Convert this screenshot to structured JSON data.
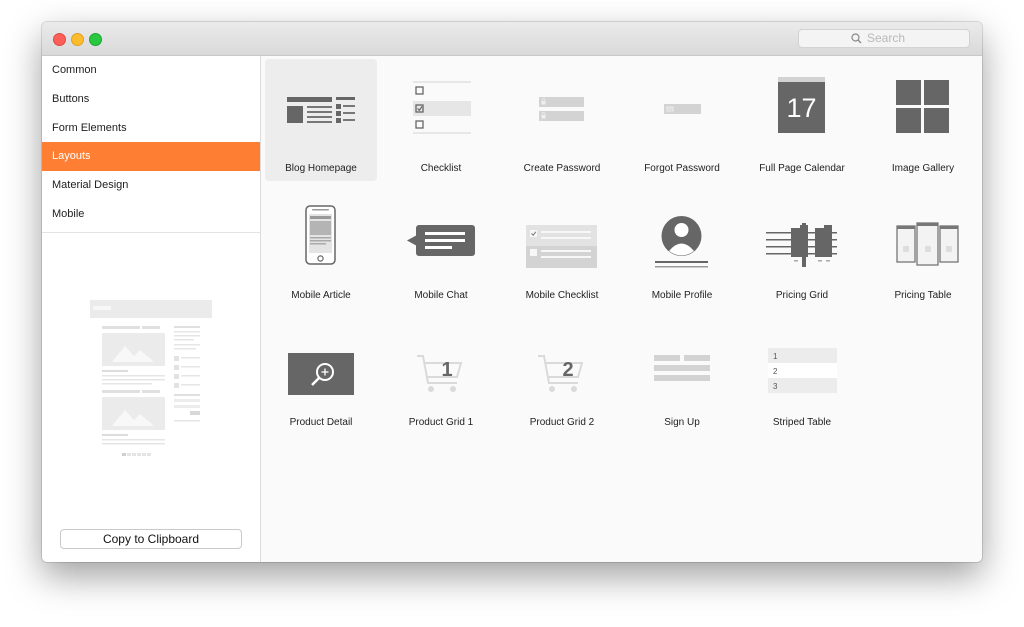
{
  "search": {
    "placeholder": "Search"
  },
  "sidebar": {
    "items": [
      {
        "label": "Common"
      },
      {
        "label": "Buttons"
      },
      {
        "label": "Form Elements"
      },
      {
        "label": "Layouts",
        "active": true
      },
      {
        "label": "Material Design"
      },
      {
        "label": "Mobile"
      }
    ],
    "copy_button": "Copy to Clipboard"
  },
  "layouts": [
    {
      "label": "Blog Homepage",
      "icon": "blog-homepage-icon",
      "selected": true
    },
    {
      "label": "Checklist",
      "icon": "checklist-icon"
    },
    {
      "label": "Create Password",
      "icon": "create-password-icon"
    },
    {
      "label": "Forgot Password",
      "icon": "forgot-password-icon"
    },
    {
      "label": "Full Page Calendar",
      "icon": "calendar-icon",
      "calendar_day": "17"
    },
    {
      "label": "Image Gallery",
      "icon": "image-gallery-icon"
    },
    {
      "label": "Mobile Article",
      "icon": "mobile-article-icon"
    },
    {
      "label": "Mobile Chat",
      "icon": "mobile-chat-icon"
    },
    {
      "label": "Mobile Checklist",
      "icon": "mobile-checklist-icon"
    },
    {
      "label": "Mobile Profile",
      "icon": "mobile-profile-icon"
    },
    {
      "label": "Pricing Grid",
      "icon": "pricing-grid-icon"
    },
    {
      "label": "Pricing Table",
      "icon": "pricing-table-icon"
    },
    {
      "label": "Product Detail",
      "icon": "product-detail-icon"
    },
    {
      "label": "Product Grid 1",
      "icon": "cart-icon",
      "cart_number": "1"
    },
    {
      "label": "Product Grid 2",
      "icon": "cart-icon",
      "cart_number": "2"
    },
    {
      "label": "Sign Up",
      "icon": "sign-up-icon"
    },
    {
      "label": "Striped Table",
      "icon": "striped-table-icon",
      "rows": [
        "1",
        "2",
        "3"
      ]
    }
  ],
  "colors": {
    "accent": "#fe7f33",
    "icon_dark": "#666666",
    "icon_light": "#d2d2d2"
  }
}
